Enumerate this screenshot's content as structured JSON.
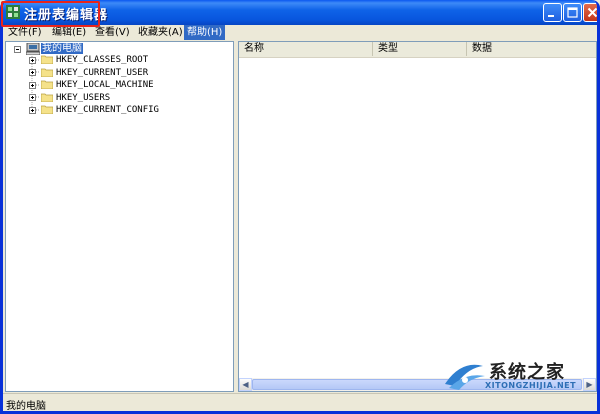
{
  "window": {
    "title": "注册表编辑器"
  },
  "menu": [
    {
      "label": "文件(F)"
    },
    {
      "label": "编辑(E)"
    },
    {
      "label": "查看(V)"
    },
    {
      "label": "收藏夹(A)"
    },
    {
      "label": "帮助(H)"
    }
  ],
  "tree": {
    "root": "我的电脑",
    "keys": [
      {
        "label": "HKEY_CLASSES_ROOT"
      },
      {
        "label": "HKEY_CURRENT_USER"
      },
      {
        "label": "HKEY_LOCAL_MACHINE"
      },
      {
        "label": "HKEY_USERS"
      },
      {
        "label": "HKEY_CURRENT_CONFIG"
      }
    ]
  },
  "list": {
    "columns": [
      {
        "label": "名称"
      },
      {
        "label": "类型"
      },
      {
        "label": "数据"
      }
    ]
  },
  "status": {
    "text": "我的电脑"
  },
  "watermark": {
    "text": "系统之家",
    "url": "XITONGZHIJIA.NET"
  },
  "colors": {
    "selection": "#316ac5",
    "highlight_box": "#e8241c",
    "titlebar": "#0855dd"
  }
}
